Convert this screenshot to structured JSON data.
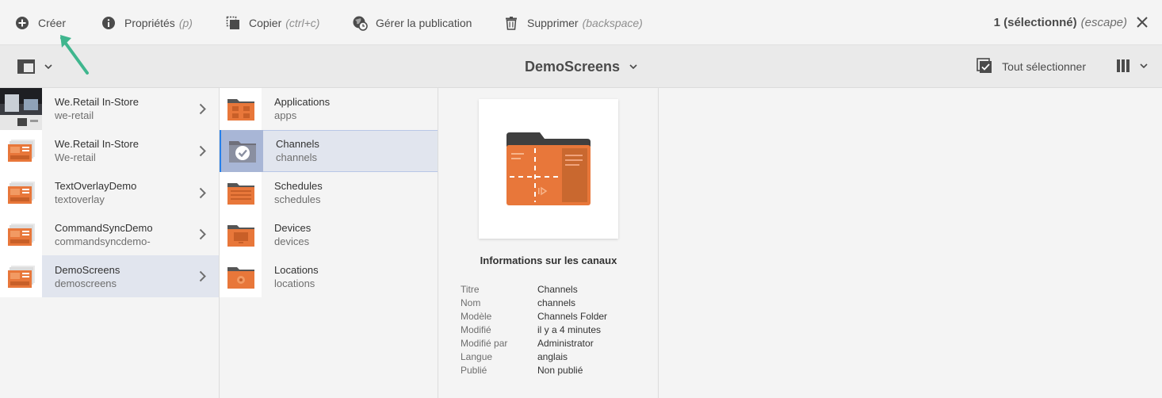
{
  "actionbar": {
    "create": {
      "label": "Créer",
      "hint": ""
    },
    "properties": {
      "label": "Propriétés",
      "hint": "(p)"
    },
    "copy": {
      "label": "Copier",
      "hint": "(ctrl+c)"
    },
    "publish": {
      "label": "Gérer la publication",
      "hint": ""
    },
    "delete": {
      "label": "Supprimer",
      "hint": "(backspace)"
    },
    "selection": {
      "count": "1 (sélectionné)",
      "hint": "(escape)"
    }
  },
  "titlebar": {
    "title": "DemoScreens",
    "select_all": "Tout sélectionner"
  },
  "column1": [
    {
      "title": "We.Retail In-Store",
      "name": "we-retail"
    },
    {
      "title": "We.Retail In-Store",
      "name": "We-retail"
    },
    {
      "title": "TextOverlayDemo",
      "name": "textoverlay"
    },
    {
      "title": "CommandSyncDemo",
      "name": "commandsyncdemo-"
    },
    {
      "title": "DemoScreens",
      "name": "demoscreens"
    }
  ],
  "column2": [
    {
      "title": "Applications",
      "name": "apps"
    },
    {
      "title": "Channels",
      "name": "channels"
    },
    {
      "title": "Schedules",
      "name": "schedules"
    },
    {
      "title": "Devices",
      "name": "devices"
    },
    {
      "title": "Locations",
      "name": "locations"
    }
  ],
  "info": {
    "heading": "Informations sur les canaux",
    "rows": [
      {
        "key": "Titre",
        "value": "Channels"
      },
      {
        "key": "Nom",
        "value": "channels"
      },
      {
        "key": "Modèle",
        "value": "Channels Folder"
      },
      {
        "key": "Modifié",
        "value": "il y a 4 minutes"
      },
      {
        "key": "Modifié par",
        "value": "Administrator"
      },
      {
        "key": "Langue",
        "value": "anglais"
      },
      {
        "key": "Publié",
        "value": "Non publié"
      }
    ]
  },
  "colors": {
    "accent": "#2680eb",
    "folder_orange": "#e8773a",
    "annotation_arrow": "#3fb68e"
  }
}
